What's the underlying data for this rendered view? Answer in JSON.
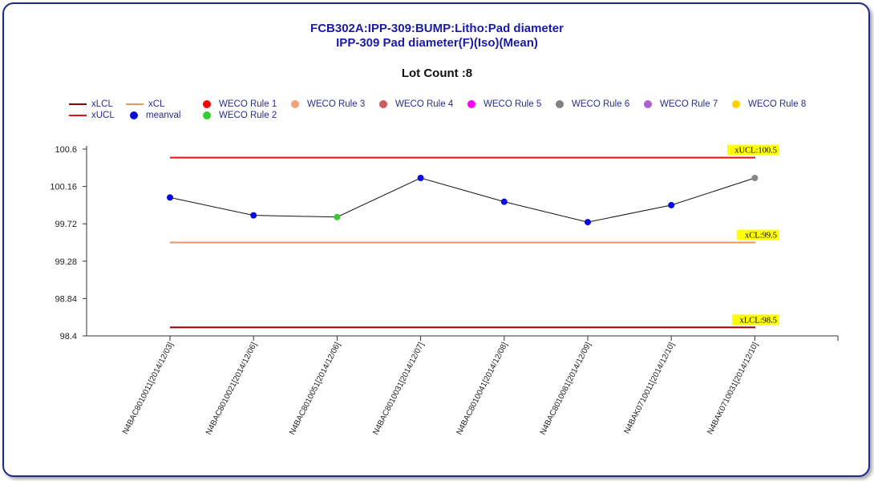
{
  "chart_data": {
    "type": "line",
    "title": "FCB302A:IPP-309:BUMP:Litho:Pad diameter",
    "subtitle": "IPP-309 Pad diameter(F)(Iso)(Mean)",
    "lot_count_text": "Lot Count :8",
    "ylim": [
      98.4,
      100.6
    ],
    "y_ticks": [
      "100.6",
      "100.16",
      "99.72",
      "99.28",
      "98.84",
      "98.4"
    ],
    "y_tick_values": [
      100.6,
      100.16,
      99.72,
      99.28,
      98.84,
      98.4
    ],
    "categories": [
      "N4BAC8010011[2014/12/03]",
      "N4BAC8010021[2014/12/06]",
      "N4BAC8010051[2014/12/06]",
      "N4BAC8010031[2014/12/07]",
      "N4BAC8010041[2014/12/08]",
      "N4BAC8010081[2014/12/09]",
      "N4BAK0710011[2014/12/10]",
      "N4BAK0710031[2014/12/10]"
    ],
    "series": [
      {
        "name": "meanval",
        "values": [
          100.03,
          99.82,
          99.8,
          100.26,
          99.98,
          99.74,
          99.94,
          100.26
        ],
        "point_colors": [
          "#0a0ae0",
          "#0a0ae0",
          "#33cc33",
          "#0a0ae0",
          "#0a0ae0",
          "#0a0ae0",
          "#0a0ae0",
          "#888888"
        ]
      }
    ],
    "control_lines": [
      {
        "name": "xUCL",
        "value": 100.5,
        "label": "xUCL:100.5",
        "color": "#e01010"
      },
      {
        "name": "xCL",
        "value": 99.5,
        "label": "xCL:99.5",
        "color": "#f09060"
      },
      {
        "name": "xLCL",
        "value": 98.5,
        "label": "xLCL:98.5",
        "color": "#8b0000"
      }
    ],
    "legend": [
      {
        "label": "xLCL",
        "kind": "line",
        "color": "#8b0000"
      },
      {
        "label": "xCL",
        "kind": "line",
        "color": "#f09060"
      },
      {
        "label": "WECO Rule 1",
        "kind": "dot",
        "color": "#ff0000"
      },
      {
        "label": "WECO Rule 3",
        "kind": "dot",
        "color": "#f4a07a"
      },
      {
        "label": "WECO Rule 4",
        "kind": "dot",
        "color": "#cd5c5c"
      },
      {
        "label": "WECO Rule 5",
        "kind": "dot",
        "color": "#ff00ff"
      },
      {
        "label": "WECO Rule 6",
        "kind": "dot",
        "color": "#808080"
      },
      {
        "label": "WECO Rule 7",
        "kind": "dot",
        "color": "#b060d0"
      },
      {
        "label": "WECO Rule 8",
        "kind": "dot",
        "color": "#ffd000"
      },
      {
        "label": "xUCL",
        "kind": "line",
        "color": "#e01010"
      },
      {
        "label": "meanval",
        "kind": "dot",
        "color": "#0a0ae0"
      },
      {
        "label": "WECO Rule 2",
        "kind": "dot",
        "color": "#33cc33"
      }
    ],
    "legend_placement": "top",
    "grid": false
  }
}
